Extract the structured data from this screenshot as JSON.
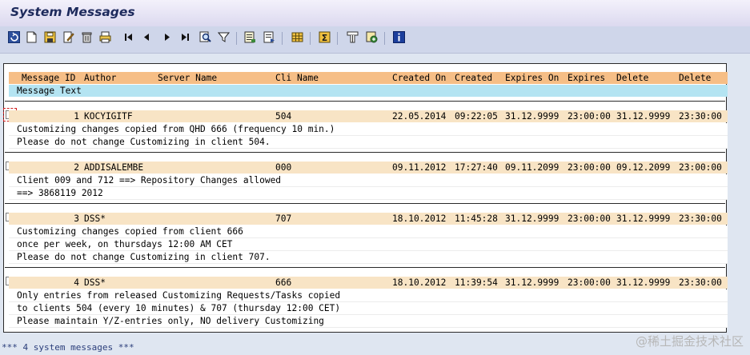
{
  "window": {
    "title": "System Messages"
  },
  "toolbar": {
    "icons": [
      "refresh-icon",
      "new-document-icon",
      "save-icon",
      "edit-icon",
      "delete-icon",
      "print-icon",
      "first-page-icon",
      "previous-page-icon",
      "next-page-icon",
      "last-page-icon",
      "find-icon",
      "filter-icon",
      "export-icon",
      "import-icon",
      "layout-icon",
      "sum-icon",
      "print-preview-icon",
      "settings-icon",
      "info-icon"
    ]
  },
  "columns": {
    "message_id": "Message ID",
    "author": "Author",
    "server_name": "Server Name",
    "cli": "Cli",
    "name": "Name",
    "created_on": "Created On",
    "created": "Created",
    "expires_on": "Expires On",
    "expires": "Expires",
    "delete_date": "Delete",
    "delete_time": "Delete",
    "message_text": "Message Text"
  },
  "messages": [
    {
      "id": "1",
      "author": "KOCYIGITF",
      "client": "504",
      "created_on": "22.05.2014",
      "created_at": "09:22:05",
      "expires_on": "31.12.9999",
      "expires_at": "23:00:00",
      "delete_on": "31.12.9999",
      "delete_at": "23:30:00",
      "lines": [
        "Customizing changes copied from QHD 666 (frequency 10 min.)",
        "Please do not change Customizing in client 504."
      ]
    },
    {
      "id": "2",
      "author": "ADDISALEMBE",
      "client": "000",
      "created_on": "09.11.2012",
      "created_at": "17:27:40",
      "expires_on": "09.11.2099",
      "expires_at": "23:00:00",
      "delete_on": "09.12.2099",
      "delete_at": "23:00:00",
      "lines": [
        "Client 009 and 712 ==> Repository Changes allowed",
        "==> 3868119 2012"
      ]
    },
    {
      "id": "3",
      "author": "DSS*",
      "client": "707",
      "created_on": "18.10.2012",
      "created_at": "11:45:28",
      "expires_on": "31.12.9999",
      "expires_at": "23:00:00",
      "delete_on": "31.12.9999",
      "delete_at": "23:30:00",
      "lines": [
        "Customizing changes copied from client 666",
        "once per week, on thursdays 12:00 AM CET",
        "Please do not change Customizing in client 707."
      ]
    },
    {
      "id": "4",
      "author": "DSS*",
      "client": "666",
      "created_on": "18.10.2012",
      "created_at": "11:39:54",
      "expires_on": "31.12.9999",
      "expires_at": "23:00:00",
      "delete_on": "31.12.9999",
      "delete_at": "23:30:00",
      "lines": [
        "Only entries from released Customizing Requests/Tasks copied",
        "to clients 504 (every 10 minutes) & 707 (thursday 12:00 CET)",
        "Please maintain Y/Z-entries only, NO delivery Customizing"
      ]
    }
  ],
  "footer": {
    "summary": "*** 4 system messages ***"
  },
  "watermark": "@稀土掘金技术社区",
  "colors": {
    "header": "#f6be86",
    "subheader": "#b4e4f2",
    "row_header": "#f8e4c5",
    "title_text": "#1d2a5c"
  }
}
